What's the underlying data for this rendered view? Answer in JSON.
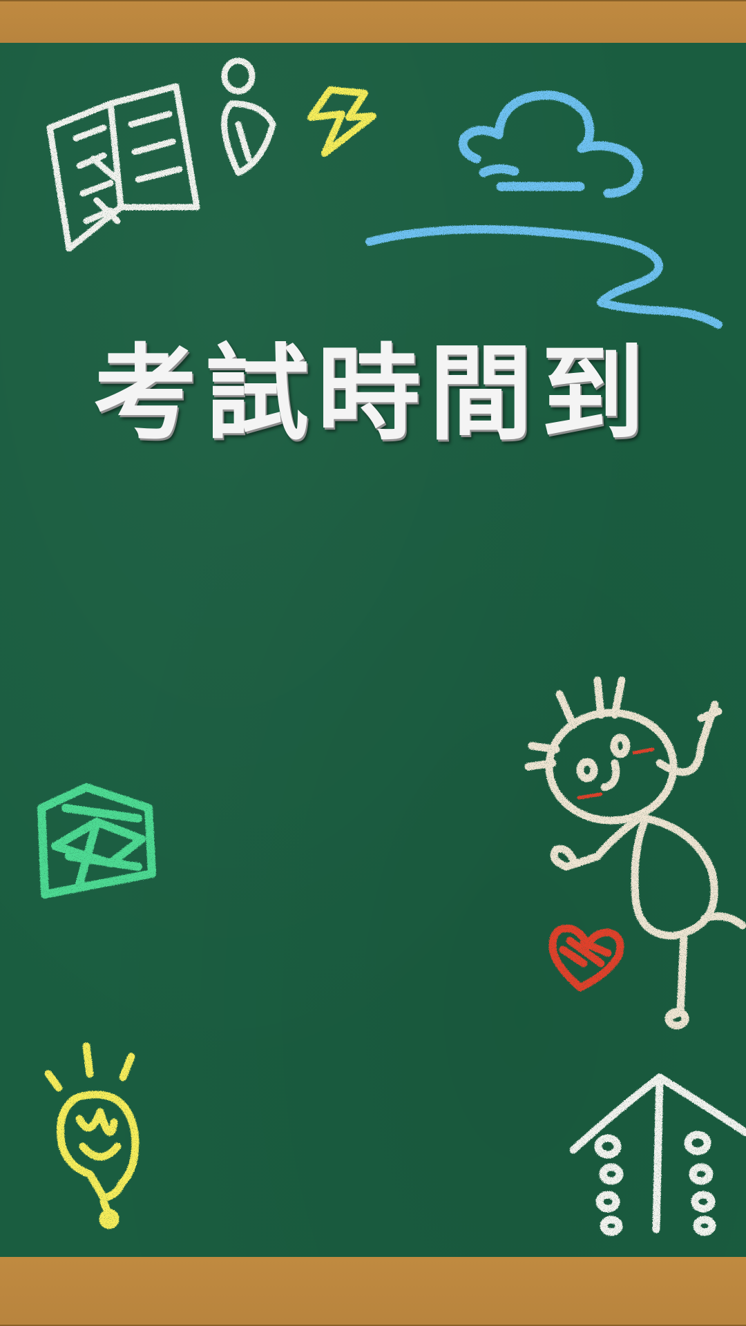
{
  "title": "考試時間到",
  "colors": {
    "board": "#1a5d40",
    "frame": "#b8843e",
    "chalk_white": "#f2f2ee",
    "chalk_blue": "#6ec0f0",
    "chalk_yellow": "#f6ec5a",
    "chalk_green": "#4ed992",
    "chalk_red": "#e0402a",
    "chalk_cream": "#eee4d2"
  },
  "icons": [
    "book-icon",
    "lightning-icon",
    "cloud-icon",
    "wind-swirl-icon",
    "diamond-icon",
    "stick-figure-icon",
    "heart-icon",
    "lightbulb-icon",
    "tree-icon"
  ]
}
